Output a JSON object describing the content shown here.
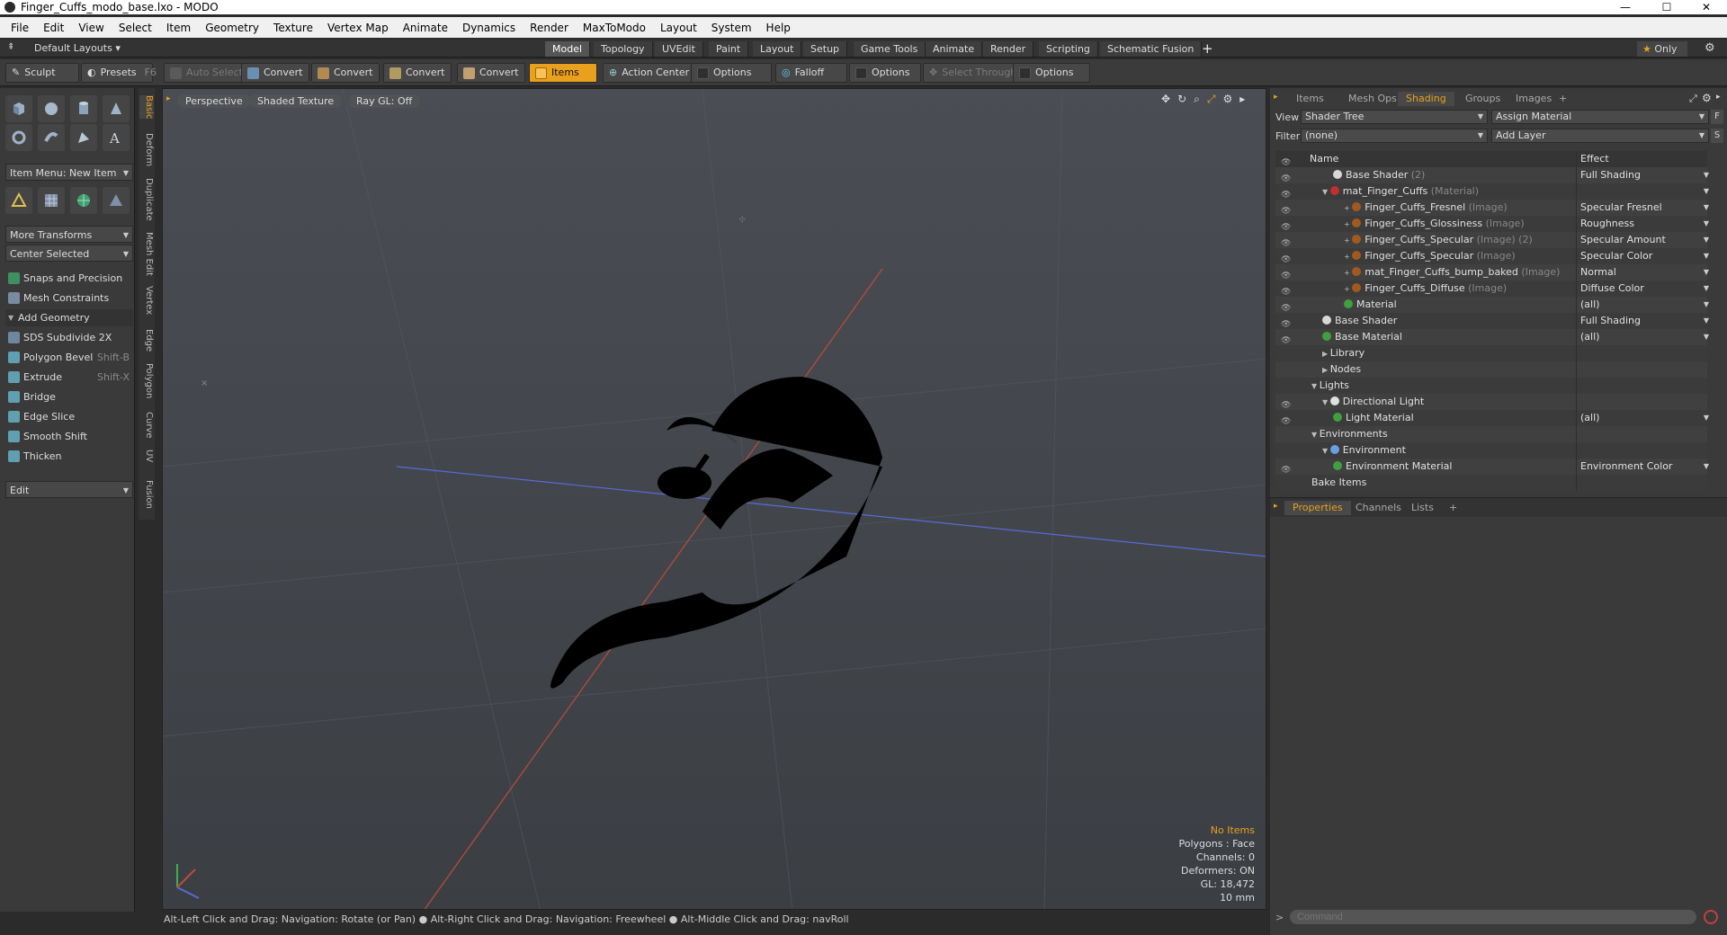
{
  "window": {
    "title": "Finger_Cuffs_modo_base.lxo - MODO",
    "minimize": "—",
    "maximize": "☐",
    "close": "✕"
  },
  "menu": [
    "File",
    "Edit",
    "View",
    "Select",
    "Item",
    "Geometry",
    "Texture",
    "Vertex Map",
    "Animate",
    "Dynamics",
    "Render",
    "MaxToModo",
    "Layout",
    "System",
    "Help"
  ],
  "layoutbar": {
    "layouts_label": "Default Layouts",
    "tabs": [
      "Model",
      "Topology",
      "UVEdit",
      "Paint",
      "Layout",
      "Setup",
      "Game Tools",
      "Animate",
      "Render",
      "Scripting",
      "Schematic Fusion"
    ],
    "active_tab": "Model",
    "add": "+",
    "only_label": "Only"
  },
  "toolbar": {
    "sculpt": "Sculpt",
    "presets": "Presets",
    "presets_key": "F6",
    "auto_select": "Auto Select",
    "convert": "Convert",
    "items": "Items",
    "action_center": "Action Center",
    "options": "Options",
    "falloff": "Falloff",
    "select_through": "Select Through"
  },
  "left": {
    "item_menu": "Item Menu: New Item",
    "more_transforms": "More Transforms",
    "center_selected": "Center Selected",
    "snaps": "Snaps and Precision",
    "mesh_constraints": "Mesh Constraints",
    "add_geometry": "Add Geometry",
    "tools": [
      {
        "label": "SDS Subdivide 2X",
        "key": ""
      },
      {
        "label": "Polygon Bevel",
        "key": "Shift-B"
      },
      {
        "label": "Extrude",
        "key": "Shift-X"
      },
      {
        "label": "Bridge",
        "key": ""
      },
      {
        "label": "Edge Slice",
        "key": ""
      },
      {
        "label": "Smooth Shift",
        "key": ""
      },
      {
        "label": "Thicken",
        "key": ""
      }
    ],
    "edit": "Edit"
  },
  "vtabs": [
    "Basic",
    "Deform",
    "Duplicate",
    "Mesh Edit",
    "Vertex",
    "Edge",
    "Polygon",
    "Curve",
    "UV",
    "Fusion"
  ],
  "viewport": {
    "perspective": "Perspective",
    "shading": "Shaded Texture",
    "raygl": "Ray GL: Off",
    "info": {
      "no_items": "No Items",
      "polygons": "Polygons : Face",
      "channels": "Channels: 0",
      "deformers": "Deformers: ON",
      "gl": "GL: 18,472",
      "scale": "10 mm"
    }
  },
  "status": "Alt-Left Click and Drag: Navigation: Rotate (or Pan) ● Alt-Right Click and Drag: Navigation: Freewheel ● Alt-Middle Click and Drag: navRoll",
  "right": {
    "tabs": [
      "Items",
      "Mesh Ops",
      "Shading",
      "Groups",
      "Images",
      "+"
    ],
    "active_tab": "Shading",
    "view_label": "View",
    "view_value": "Shader Tree",
    "assign_material": "Assign Material",
    "f_btn": "F",
    "filter_label": "Filter",
    "filter_value": "(none)",
    "add_layer": "Add Layer",
    "s_btn": "S",
    "col_name": "Name",
    "col_effect": "Effect",
    "rows": [
      {
        "name": "Base Shader",
        "suffix": " (2)",
        "effect": "Full Shading",
        "indent": 3,
        "eye": true,
        "color": "#d8d8d8",
        "dd": true
      },
      {
        "name": "mat_Finger_Cuffs",
        "suffix": " (Material)",
        "effect": "",
        "indent": 2,
        "eye": true,
        "color": "#c03030",
        "dd": true,
        "exp": "▼"
      },
      {
        "name": "Finger_Cuffs_Fresnel",
        "suffix": " (Image)",
        "effect": "Specular Fresnel",
        "indent": 4,
        "eye": true,
        "color": "#a05a20",
        "dd": true,
        "exp": "+"
      },
      {
        "name": "Finger_Cuffs_Glossiness",
        "suffix": " (Image)",
        "effect": "Roughness",
        "indent": 4,
        "eye": true,
        "color": "#a05a20",
        "dd": true,
        "exp": "+"
      },
      {
        "name": "Finger_Cuffs_Specular",
        "suffix": " (Image) (2)",
        "effect": "Specular Amount",
        "indent": 4,
        "eye": true,
        "color": "#a05a20",
        "dd": true,
        "exp": "+"
      },
      {
        "name": "Finger_Cuffs_Specular",
        "suffix": " (Image)",
        "effect": "Specular Color",
        "indent": 4,
        "eye": true,
        "color": "#a05a20",
        "dd": true,
        "exp": "+"
      },
      {
        "name": "mat_Finger_Cuffs_bump_baked",
        "suffix": " (Image)",
        "effect": "Normal",
        "indent": 4,
        "eye": true,
        "color": "#a05a20",
        "dd": true,
        "exp": "+"
      },
      {
        "name": "Finger_Cuffs_Diffuse",
        "suffix": " (Image)",
        "effect": "Diffuse Color",
        "indent": 4,
        "eye": true,
        "color": "#a05a20",
        "dd": true,
        "exp": "+"
      },
      {
        "name": "Material",
        "suffix": "",
        "effect": "(all)",
        "indent": 4,
        "eye": true,
        "color": "#40a040",
        "dd": true
      },
      {
        "name": "Base Shader",
        "suffix": "",
        "effect": "Full Shading",
        "indent": 2,
        "eye": true,
        "color": "#d8d8d8",
        "dd": true
      },
      {
        "name": "Base Material",
        "suffix": "",
        "effect": "(all)",
        "indent": 2,
        "eye": true,
        "color": "#40a040",
        "dd": true
      },
      {
        "name": "Library",
        "suffix": "",
        "effect": "",
        "indent": 2,
        "eye": false,
        "color": "",
        "exp": "▶"
      },
      {
        "name": "Nodes",
        "suffix": "",
        "effect": "",
        "indent": 2,
        "eye": false,
        "color": "",
        "exp": "▶"
      },
      {
        "name": "Lights",
        "suffix": "",
        "effect": "",
        "indent": 1,
        "eye": false,
        "color": "",
        "exp": "▼"
      },
      {
        "name": "Directional Light",
        "suffix": "",
        "effect": "",
        "indent": 2,
        "eye": true,
        "color": "#e0e0e0",
        "exp": "▼"
      },
      {
        "name": "Light Material",
        "suffix": "",
        "effect": "(all)",
        "indent": 3,
        "eye": true,
        "color": "#40a040",
        "dd": true
      },
      {
        "name": "Environments",
        "suffix": "",
        "effect": "",
        "indent": 1,
        "eye": false,
        "color": "",
        "exp": "▼"
      },
      {
        "name": "Environment",
        "suffix": "",
        "effect": "",
        "indent": 2,
        "eye": false,
        "color": "#6aa0e0",
        "exp": "▼"
      },
      {
        "name": "Environment Material",
        "suffix": "",
        "effect": "Environment Color",
        "indent": 3,
        "eye": true,
        "color": "#40a040",
        "dd": true
      },
      {
        "name": "Bake Items",
        "suffix": "",
        "effect": "",
        "indent": 1,
        "eye": false,
        "color": ""
      }
    ],
    "props_tabs": [
      "Properties",
      "Channels",
      "Lists",
      "+"
    ],
    "command_placeholder": "Command"
  }
}
